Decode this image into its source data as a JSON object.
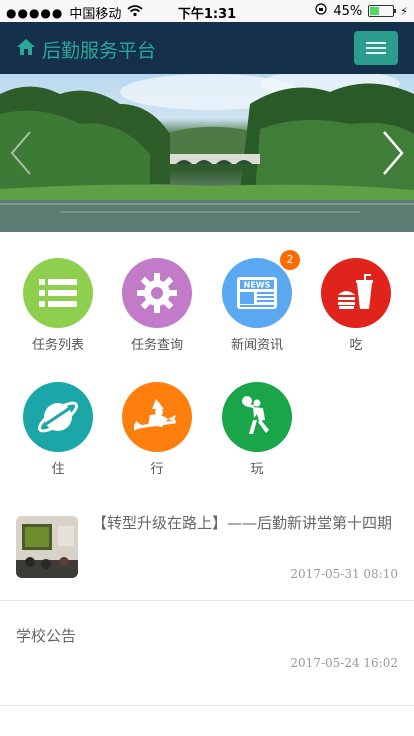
{
  "status_bar": {
    "signal": "●●●●●",
    "carrier": "中国移动",
    "time": "下午1:31",
    "battery": "45%"
  },
  "header": {
    "title": "后勤服务平台",
    "home_icon": "home-icon",
    "menu_icon": "hamburger-menu-icon"
  },
  "banner": {
    "prev_icon": "chevron-left-icon",
    "next_icon": "chevron-right-icon"
  },
  "grid": {
    "items": [
      {
        "label": "任务列表",
        "color": "#8fcf4f",
        "icon": "list-icon"
      },
      {
        "label": "任务查询",
        "color": "#c27bc9",
        "icon": "gear-icon"
      },
      {
        "label": "新闻资讯",
        "color": "#5aa7f2",
        "icon": "news-icon",
        "badge": "2"
      },
      {
        "label": "吃",
        "color": "#e0241b",
        "icon": "fastfood-icon"
      },
      {
        "label": "住",
        "color": "#1ba7a7",
        "icon": "planet-icon"
      },
      {
        "label": "行",
        "color": "#ff7f0e",
        "icon": "witch-broom-icon"
      },
      {
        "label": "玩",
        "color": "#1aa54a",
        "icon": "basketball-player-icon"
      }
    ]
  },
  "news_item": {
    "title": "【转型升级在路上】——后勤新讲堂第十四期",
    "date": "2017-05-31 08:10"
  },
  "notice_item": {
    "title": "学校公告",
    "date": "2017-05-24 16:02"
  }
}
